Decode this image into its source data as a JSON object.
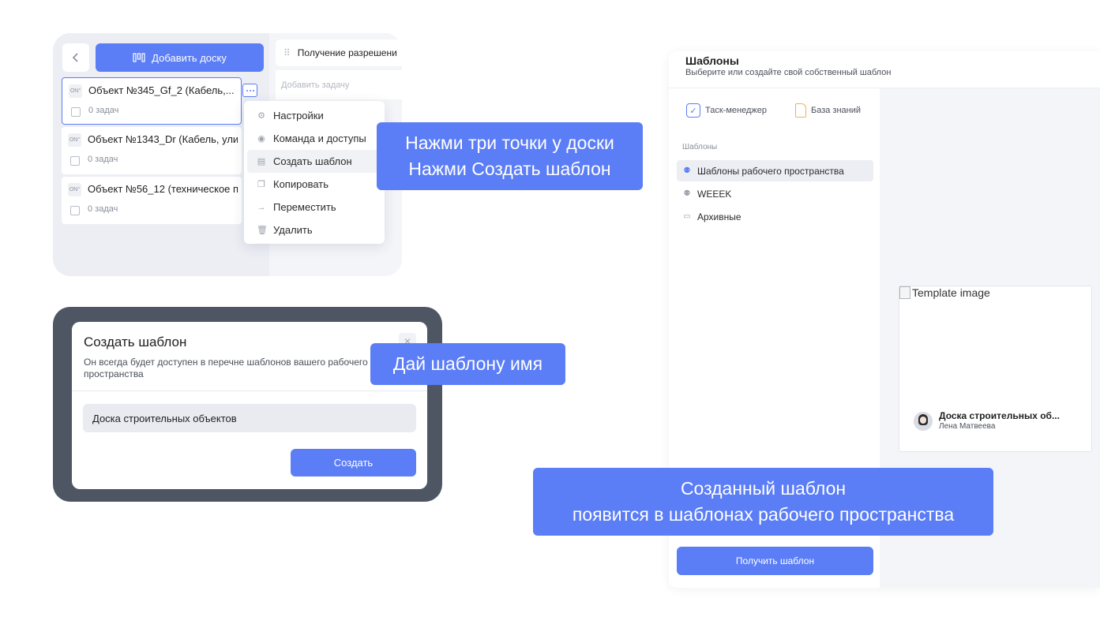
{
  "colors": {
    "accent": "#5b7df6",
    "dark_frame": "#4f5663",
    "panel_bg": "#eceef4"
  },
  "board_panel": {
    "back_icon": "chevron-left-icon",
    "add_board_label": "Добавить доску",
    "column_title": "Получение разрешени",
    "add_task_placeholder": "Добавить задачу",
    "boards": [
      {
        "icon": "ON°",
        "title": "Объект №345_Gf_2 (Кабель,...",
        "tasks": "0 задач"
      },
      {
        "icon": "ON°",
        "title": "Объект №1343_Dr (Кабель, ули",
        "tasks": "0 задач"
      },
      {
        "icon": "ON°",
        "title": "Объект №56_12 (техническое п",
        "tasks": "0 задач"
      }
    ],
    "menu": [
      {
        "label": "Настройки",
        "icon": "gear-icon"
      },
      {
        "label": "Команда и доступы",
        "icon": "eye-icon"
      },
      {
        "label": "Создать шаблон",
        "icon": "template-icon"
      },
      {
        "label": "Копировать",
        "icon": "copy-icon"
      },
      {
        "label": "Переместить",
        "icon": "arrow-right-icon"
      },
      {
        "label": "Удалить",
        "icon": "trash-icon"
      }
    ]
  },
  "callouts": {
    "step1_line1": "Нажми три точки у доски",
    "step1_line2": "Нажми Создать шаблон",
    "step2": "Дай шаблону имя",
    "step3_line1": "Созданный шаблон",
    "step3_line2": "появится в шаблонах рабочего пространства"
  },
  "dialog": {
    "title": "Создать шаблон",
    "description": "Он всегда будет доступен в перечне шаблонов вашего рабочего пространства",
    "input_value": "Доска строительных объектов",
    "create_label": "Создать",
    "close_icon": "close-icon"
  },
  "templates": {
    "title": "Шаблоны",
    "subtitle": "Выберите или создайте свой собственный шаблон",
    "tabs": [
      {
        "label": "Таск-менеджер",
        "icon": "check-square-icon"
      },
      {
        "label": "База знаний",
        "icon": "document-icon"
      }
    ],
    "section_heading": "Шаблоны",
    "items": [
      {
        "label": "Шаблоны рабочего пространства",
        "selected": true
      },
      {
        "label": "WEEEK",
        "selected": false
      },
      {
        "label": "Архивные",
        "selected": false
      }
    ],
    "get_button": "Получить шаблон",
    "card": {
      "image_alt": "Template image",
      "name": "Доска строительных об...",
      "author": "Лена Матвеева"
    }
  }
}
